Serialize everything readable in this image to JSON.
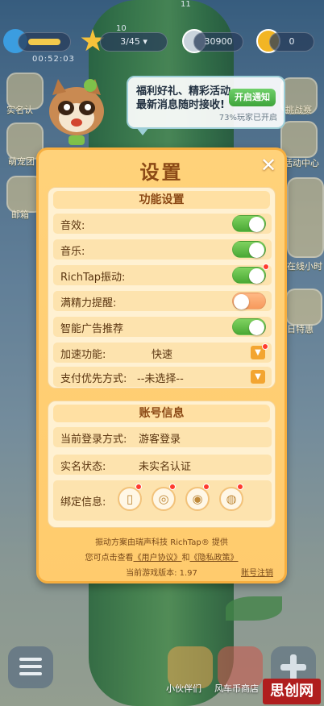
{
  "status": {
    "level_top": "11",
    "level_progress": "3/45",
    "level_number": "10",
    "coins": "30900",
    "gems": "0",
    "timer": "00:52:03"
  },
  "side_menu": {
    "left": [
      "实名认",
      "萌宠团",
      "邮箱"
    ],
    "right": [
      "挑战赛",
      "活动中心",
      "在线小时",
      "日特惠"
    ]
  },
  "notice": {
    "line1": "福利好礼、精彩活动",
    "line2": "最新消息随时接收!",
    "button": "开启通知",
    "sub": "73%玩家已开启"
  },
  "dialog": {
    "title": "设置",
    "close": "✕",
    "function_section": {
      "header": "功能设置",
      "rows": [
        {
          "label": "音效:",
          "state": "on"
        },
        {
          "label": "音乐:",
          "state": "on"
        },
        {
          "label": "RichTap振动:",
          "state": "on"
        },
        {
          "label": "满精力提醒:",
          "state": "off"
        },
        {
          "label": "智能广告推荐",
          "state": "on"
        }
      ],
      "speed_label": "加速功能:",
      "speed_value": "快速",
      "pay_label": "支付优先方式:",
      "pay_value": "--未选择--"
    },
    "account_section": {
      "header": "账号信息",
      "login_label": "当前登录方式:",
      "login_value": "游客登录",
      "realname_label": "实名状态:",
      "realname_value": "未实名认证",
      "bind_label": "绑定信息:"
    },
    "footer": {
      "line1": "振动方案由瑞声科技 RichTap® 提供",
      "line2_pre": "您可点击查看",
      "user_agreement": "《用户协议》",
      "line2_and": "和",
      "privacy_policy": "《隐私政策》",
      "version": "当前游戏版本: 1.97",
      "logout": "账号注销"
    }
  },
  "bottom": {
    "labels": [
      "小伙伴们",
      "风车币商店"
    ]
  },
  "watermark": "思创网",
  "colors": {
    "dialog_bg": "#ffcb6d",
    "toggle_on": "#4aa935",
    "toggle_off": "#f79a5c",
    "title": "#8c4a16"
  }
}
